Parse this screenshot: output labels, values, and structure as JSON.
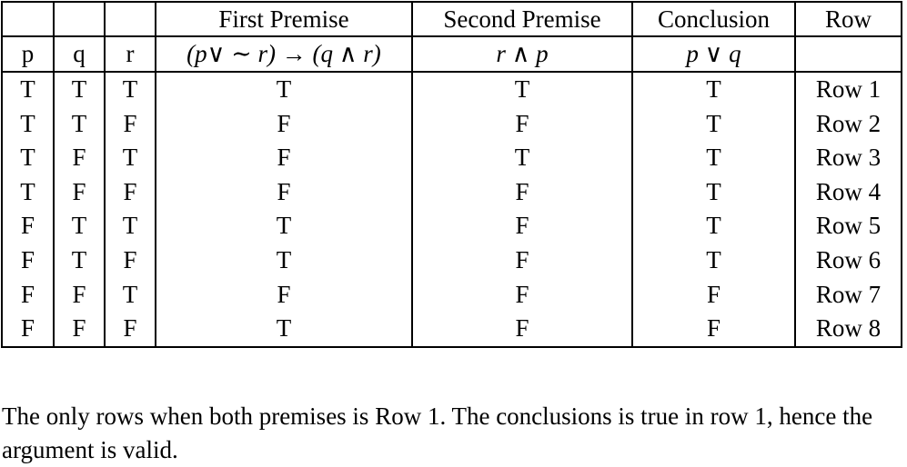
{
  "table": {
    "header_row_1": [
      "",
      "",
      "",
      "First Premise",
      "Second Premise",
      "Conclusion",
      "Row"
    ],
    "header_row_2": [
      "p",
      "q",
      "r",
      "(p∨ ∼ r) → (q ∧ r)",
      "r ∧ p",
      "p ∨ q",
      ""
    ],
    "rows": [
      [
        "T",
        "T",
        "T",
        "T",
        "T",
        "T",
        "Row 1"
      ],
      [
        "T",
        "T",
        "F",
        "F",
        "F",
        "T",
        "Row 2"
      ],
      [
        "T",
        "F",
        "T",
        "F",
        "T",
        "T",
        "Row 3"
      ],
      [
        "T",
        "F",
        "F",
        "F",
        "F",
        "T",
        "Row 4"
      ],
      [
        "F",
        "T",
        "T",
        "T",
        "F",
        "T",
        "Row 5"
      ],
      [
        "F",
        "T",
        "F",
        "T",
        "F",
        "T",
        "Row 6"
      ],
      [
        "F",
        "F",
        "T",
        "F",
        "F",
        "F",
        "Row 7"
      ],
      [
        "F",
        "F",
        "F",
        "T",
        "F",
        "F",
        "Row 8"
      ]
    ]
  },
  "note": "The only rows when both premises is Row 1. The conclusions is true in row 1, hence the argument is valid."
}
